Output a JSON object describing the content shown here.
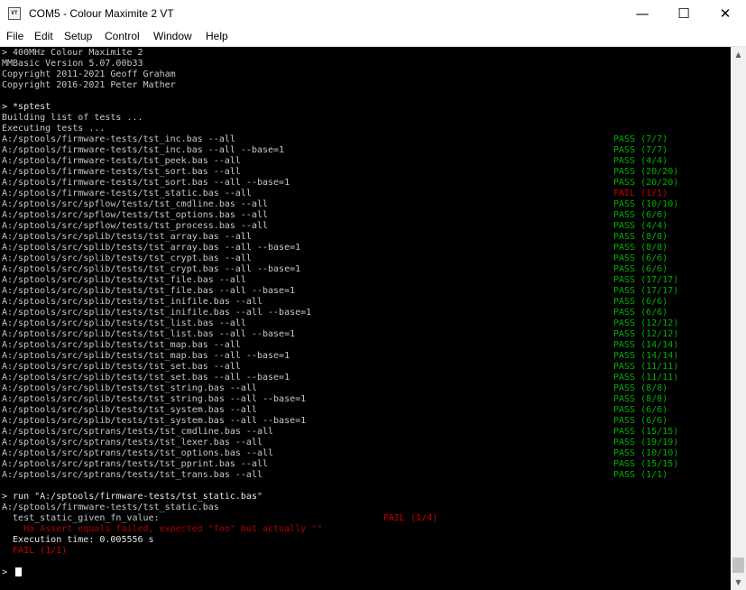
{
  "window": {
    "icon_text": "VT",
    "title": "COM5 - Colour Maximite 2 VT",
    "minimize_glyph": "—",
    "maximize_glyph": "☐",
    "close_glyph": "✕"
  },
  "menu": [
    {
      "label": "File"
    },
    {
      "label": "Edit"
    },
    {
      "label": "Setup"
    },
    {
      "label": "Control"
    },
    {
      "label": "Window"
    },
    {
      "label": "Help"
    }
  ],
  "colors": {
    "pass": "#00b000",
    "fail": "#d00000",
    "background": "#000000",
    "text": "#c8c8c8"
  },
  "terminal": {
    "header": [
      "> 400MHz Colour Maximite 2",
      "MMBasic Version 5.07.00b33",
      "Copyright 2011-2021 Geoff Graham",
      "Copyright 2016-2021 Peter Mather"
    ],
    "command": "> *sptest",
    "building": "Building list of tests ...",
    "executing": "Executing tests ...",
    "tests": [
      {
        "cmd": "A:/sptools/firmware-tests/tst_inc.bas --all",
        "result": "PASS (7/7)",
        "status": "pass"
      },
      {
        "cmd": "A:/sptools/firmware-tests/tst_inc.bas --all --base=1",
        "result": "PASS (7/7)",
        "status": "pass"
      },
      {
        "cmd": "A:/sptools/firmware-tests/tst_peek.bas --all",
        "result": "PASS (4/4)",
        "status": "pass"
      },
      {
        "cmd": "A:/sptools/firmware-tests/tst_sort.bas --all",
        "result": "PASS (20/20)",
        "status": "pass"
      },
      {
        "cmd": "A:/sptools/firmware-tests/tst_sort.bas --all --base=1",
        "result": "PASS (20/20)",
        "status": "pass"
      },
      {
        "cmd": "A:/sptools/firmware-tests/tst_static.bas --all",
        "result": "FAIL (1/1)",
        "status": "fail"
      },
      {
        "cmd": "A:/sptools/src/spflow/tests/tst_cmdline.bas --all",
        "result": "PASS (10/10)",
        "status": "pass"
      },
      {
        "cmd": "A:/sptools/src/spflow/tests/tst_options.bas --all",
        "result": "PASS (6/6)",
        "status": "pass"
      },
      {
        "cmd": "A:/sptools/src/spflow/tests/tst_process.bas --all",
        "result": "PASS (4/4)",
        "status": "pass"
      },
      {
        "cmd": "A:/sptools/src/splib/tests/tst_array.bas --all",
        "result": "PASS (8/8)",
        "status": "pass"
      },
      {
        "cmd": "A:/sptools/src/splib/tests/tst_array.bas --all --base=1",
        "result": "PASS (8/8)",
        "status": "pass"
      },
      {
        "cmd": "A:/sptools/src/splib/tests/tst_crypt.bas --all",
        "result": "PASS (6/6)",
        "status": "pass"
      },
      {
        "cmd": "A:/sptools/src/splib/tests/tst_crypt.bas --all --base=1",
        "result": "PASS (6/6)",
        "status": "pass"
      },
      {
        "cmd": "A:/sptools/src/splib/tests/tst_file.bas --all",
        "result": "PASS (17/17)",
        "status": "pass"
      },
      {
        "cmd": "A:/sptools/src/splib/tests/tst_file.bas --all --base=1",
        "result": "PASS (17/17)",
        "status": "pass"
      },
      {
        "cmd": "A:/sptools/src/splib/tests/tst_inifile.bas --all",
        "result": "PASS (6/6)",
        "status": "pass"
      },
      {
        "cmd": "A:/sptools/src/splib/tests/tst_inifile.bas --all --base=1",
        "result": "PASS (6/6)",
        "status": "pass"
      },
      {
        "cmd": "A:/sptools/src/splib/tests/tst_list.bas --all",
        "result": "PASS (12/12)",
        "status": "pass"
      },
      {
        "cmd": "A:/sptools/src/splib/tests/tst_list.bas --all --base=1",
        "result": "PASS (12/12)",
        "status": "pass"
      },
      {
        "cmd": "A:/sptools/src/splib/tests/tst_map.bas --all",
        "result": "PASS (14/14)",
        "status": "pass"
      },
      {
        "cmd": "A:/sptools/src/splib/tests/tst_map.bas --all --base=1",
        "result": "PASS (14/14)",
        "status": "pass"
      },
      {
        "cmd": "A:/sptools/src/splib/tests/tst_set.bas --all",
        "result": "PASS (11/11)",
        "status": "pass"
      },
      {
        "cmd": "A:/sptools/src/splib/tests/tst_set.bas --all --base=1",
        "result": "PASS (11/11)",
        "status": "pass"
      },
      {
        "cmd": "A:/sptools/src/splib/tests/tst_string.bas --all",
        "result": "PASS (8/8)",
        "status": "pass"
      },
      {
        "cmd": "A:/sptools/src/splib/tests/tst_string.bas --all --base=1",
        "result": "PASS (8/8)",
        "status": "pass"
      },
      {
        "cmd": "A:/sptools/src/splib/tests/tst_system.bas --all",
        "result": "PASS (6/6)",
        "status": "pass"
      },
      {
        "cmd": "A:/sptools/src/splib/tests/tst_system.bas --all --base=1",
        "result": "PASS (6/6)",
        "status": "pass"
      },
      {
        "cmd": "A:/sptools/src/sptrans/tests/tst_cmdline.bas --all",
        "result": "PASS (15/15)",
        "status": "pass"
      },
      {
        "cmd": "A:/sptools/src/sptrans/tests/tst_lexer.bas --all",
        "result": "PASS (19/19)",
        "status": "pass"
      },
      {
        "cmd": "A:/sptools/src/sptrans/tests/tst_options.bas --all",
        "result": "PASS (10/10)",
        "status": "pass"
      },
      {
        "cmd": "A:/sptools/src/sptrans/tests/tst_pprint.bas --all",
        "result": "PASS (15/15)",
        "status": "pass"
      },
      {
        "cmd": "A:/sptools/src/sptrans/tests/tst_trans.bas --all",
        "result": "PASS (1/1)",
        "status": "pass"
      }
    ],
    "run_command": "> run \"A:/sptools/firmware-tests/tst_static.bas\"",
    "run_file": "A:/sptools/firmware-tests/tst_static.bas",
    "test_name": "  test_static_given_fn_value:",
    "test_result": "FAIL (1/4)",
    "assert_message": "    Ha Assert equals failed, expected \"foo\" but actually \"\"",
    "execution_time": "  Execution time: 0.005556 s",
    "final_result": "  FAIL (1/1)",
    "prompt": "> "
  }
}
